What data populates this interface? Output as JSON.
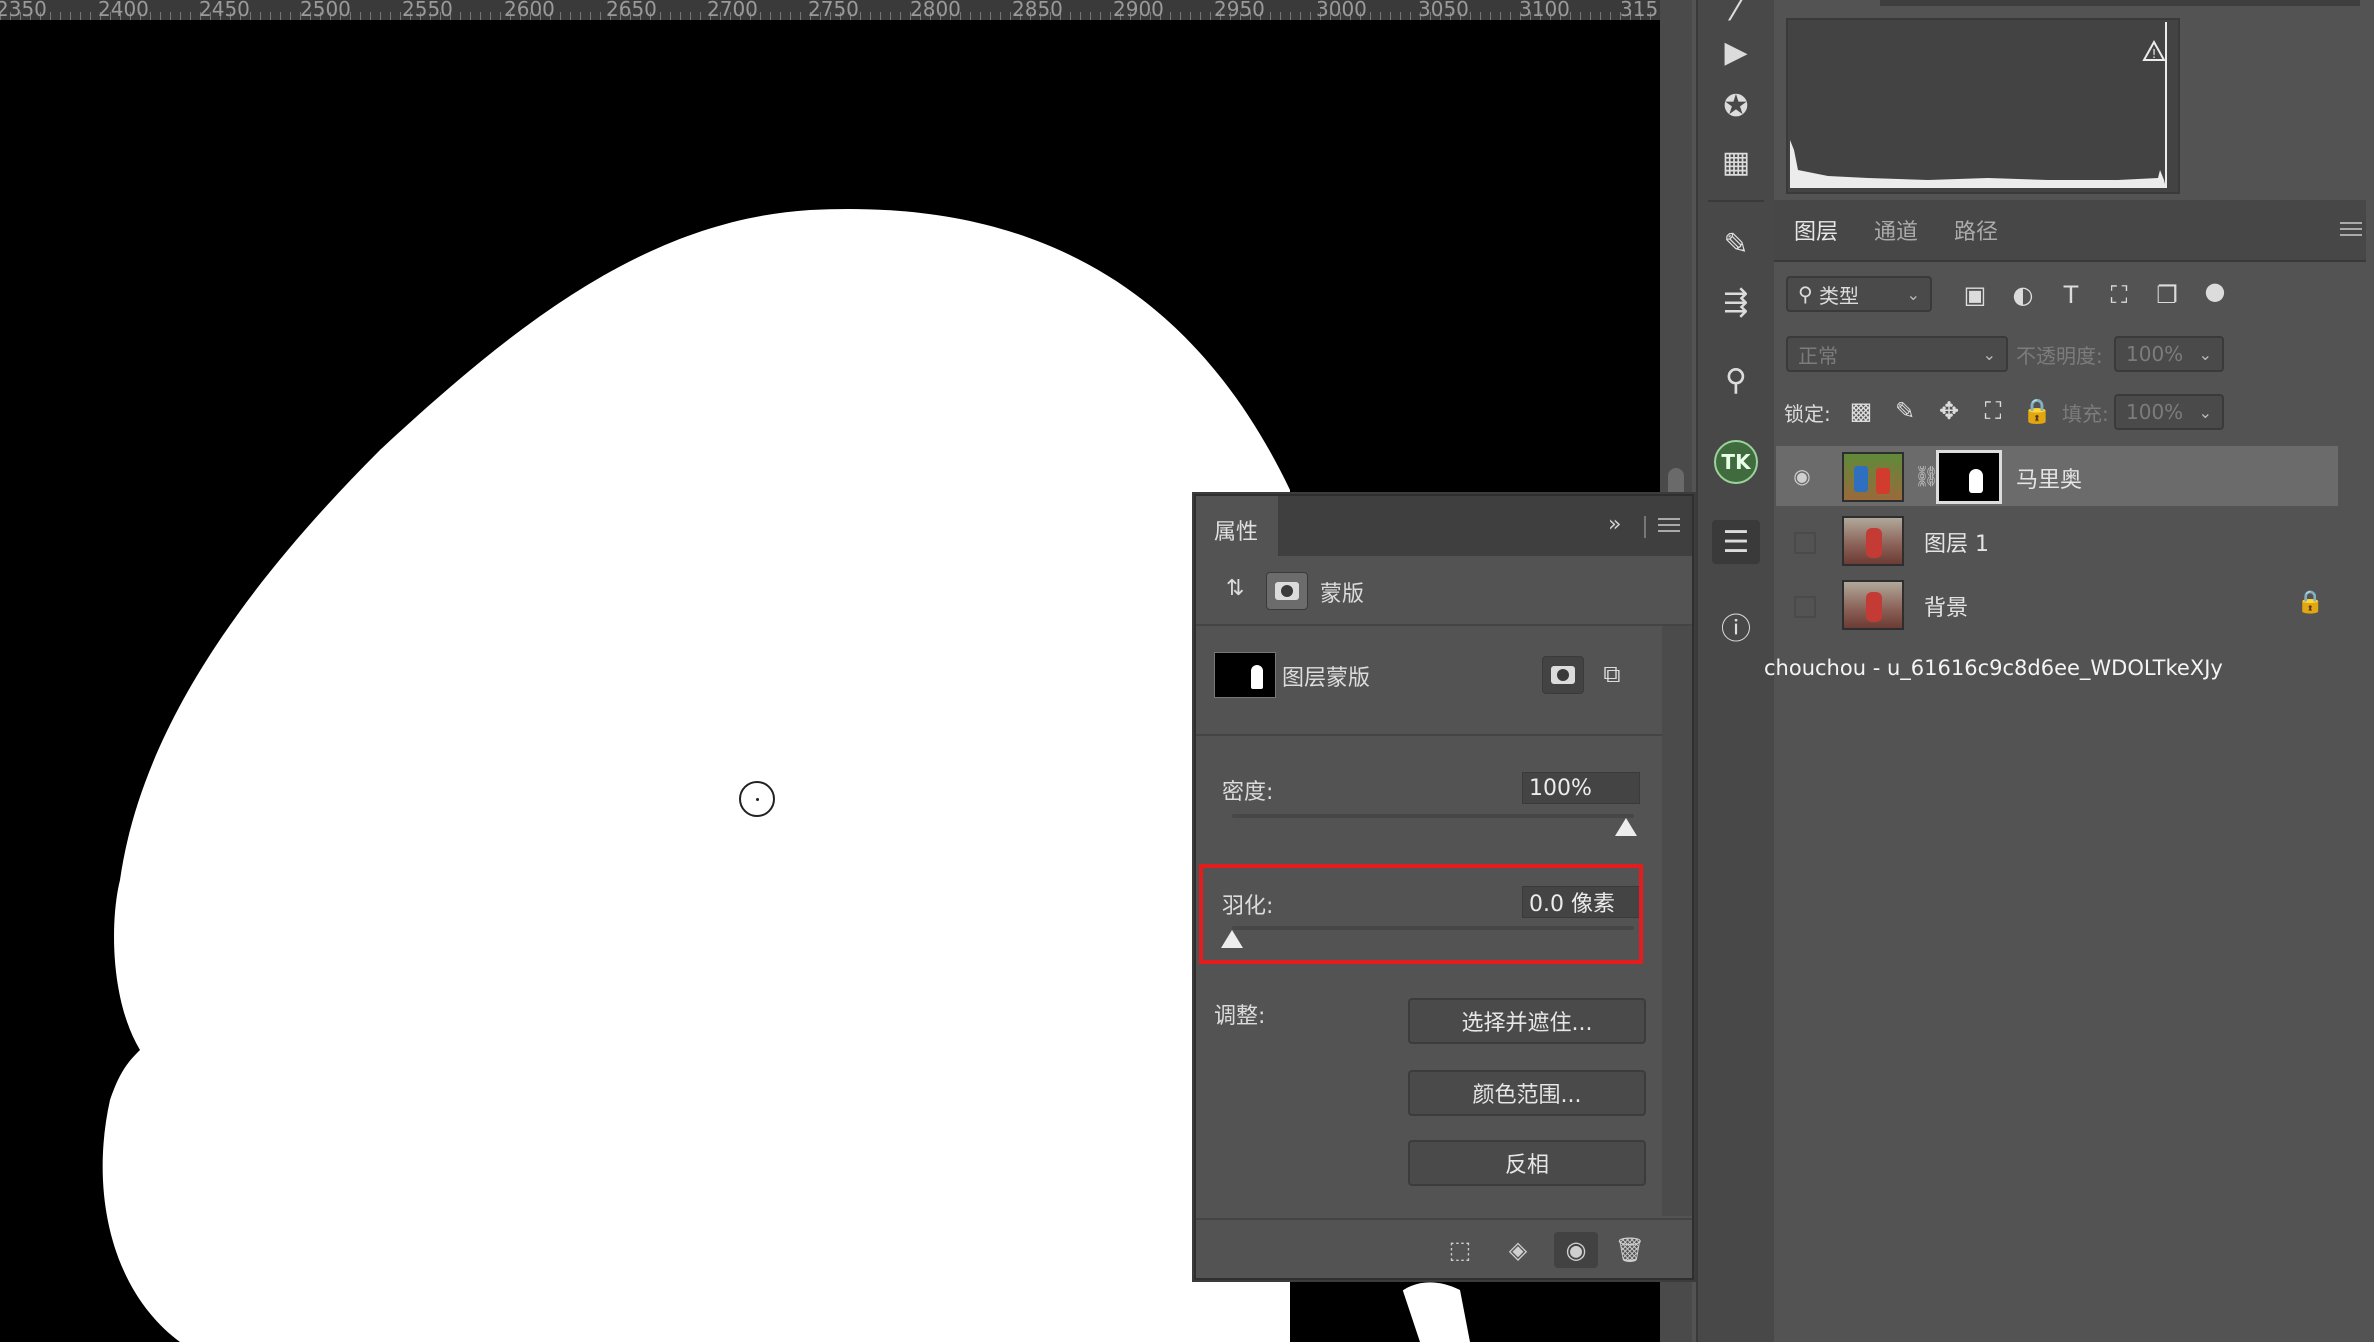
{
  "ruler": {
    "labels": [
      "2350",
      "2400",
      "2450",
      "2500",
      "2550",
      "2600",
      "2650",
      "2700",
      "2750",
      "2800",
      "2850",
      "2900",
      "2950",
      "3000",
      "3050",
      "3100",
      "315"
    ]
  },
  "layers_panel": {
    "tabs": [
      "图层",
      "通道",
      "路径"
    ],
    "active_tab": "图层",
    "filter_kind": "类型",
    "blend_mode": "正常",
    "opacity_label": "不透明度:",
    "opacity_value": "100%",
    "lock_label": "锁定:",
    "fill_label": "填充:",
    "fill_value": "100%",
    "layers": [
      {
        "name": "马里奥",
        "visible": true,
        "selected": true,
        "has_mask": true
      },
      {
        "name": "图层 1",
        "visible": false,
        "selected": false
      },
      {
        "name": "背景",
        "visible": false,
        "selected": false,
        "locked": true
      }
    ]
  },
  "watermark": "chouchou - u_61616c9c8d6ee_WDOLTkeXJy",
  "properties_panel": {
    "title": "属性",
    "expand_icon": "double-chevron-right-icon",
    "section_label": "蒙版",
    "mask_type_label": "图层蒙版",
    "density_label": "密度:",
    "density_value": "100%",
    "density_percent": 100,
    "feather_label": "羽化:",
    "feather_value": "0.0 像素",
    "feather_fraction": 0,
    "adjust_label": "调整:",
    "buttons": [
      "选择并遮住...",
      "颜色范围...",
      "反相"
    ]
  },
  "tools": [
    "brush-preset-icon",
    "play-icon",
    "color-palette-icon",
    "table-icon",
    "brush-settings-icon",
    "adjust-brush-icon",
    "clone-source-icon",
    "tk-plugin-icon",
    "properties-sliders-icon",
    "info-icon"
  ],
  "colors": {
    "canvas_bg": "#000000",
    "mask_shape": "#ffffff",
    "highlight": "#e31d1d",
    "panel_bg": "#535353"
  }
}
